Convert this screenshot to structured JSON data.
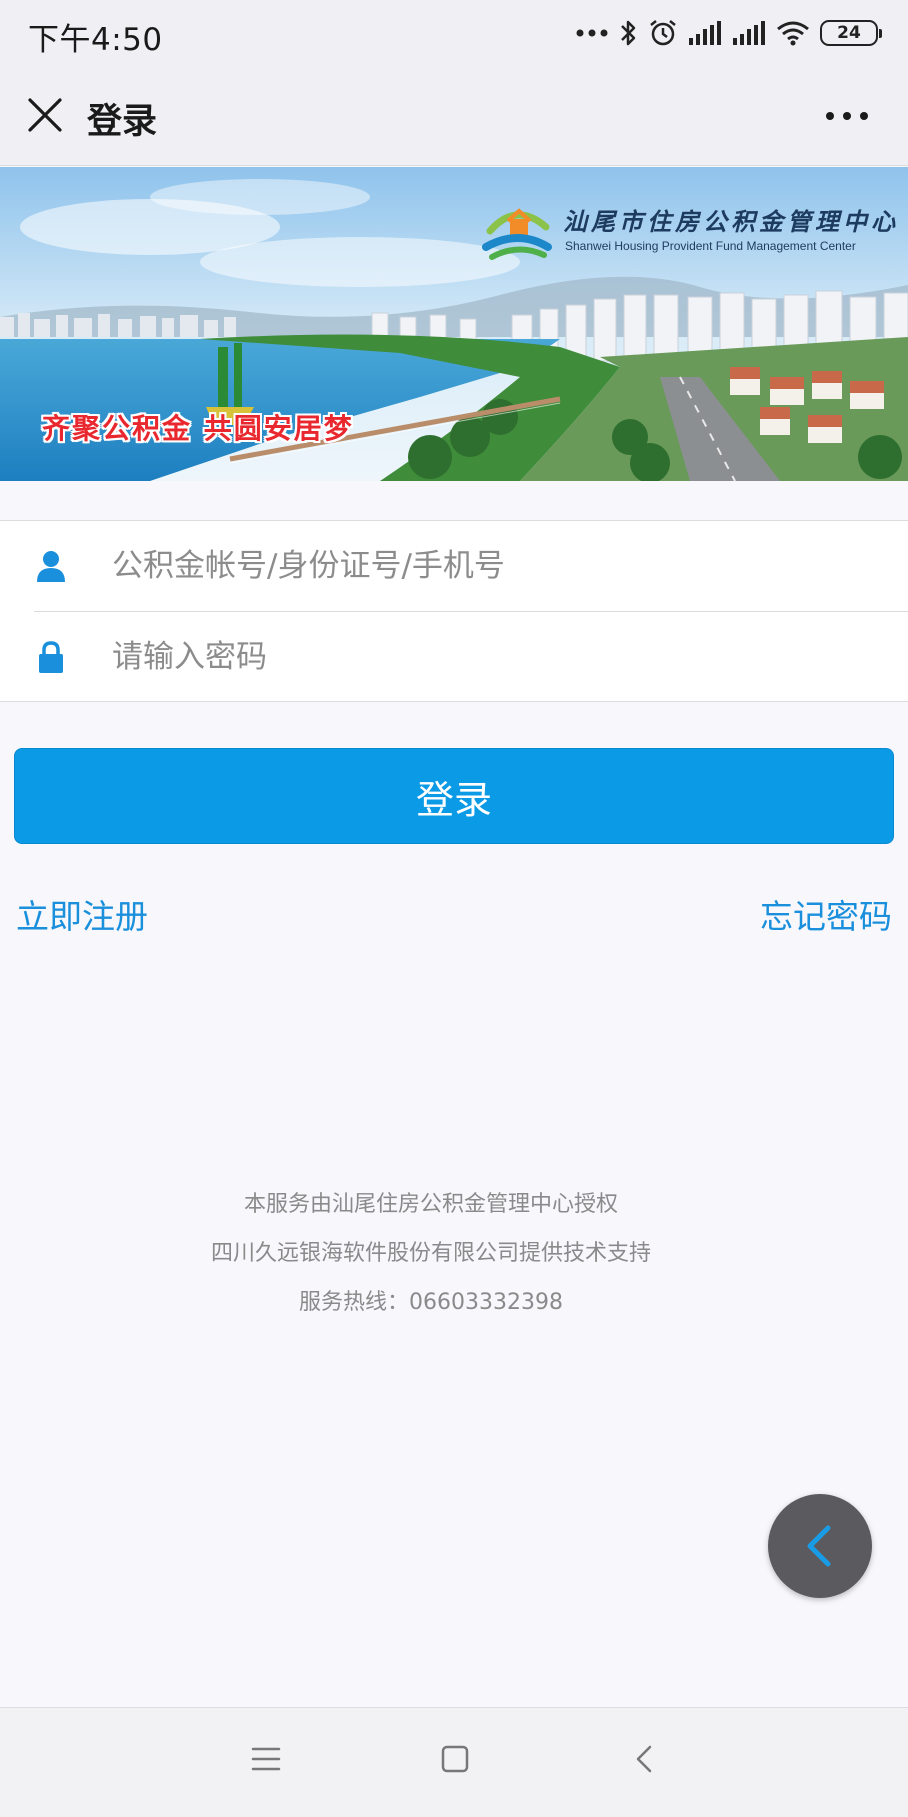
{
  "status_bar": {
    "time": "下午4:50",
    "battery": "24",
    "icons": [
      "more-dots-icon",
      "bluetooth-icon",
      "alarm-icon",
      "signal-icon",
      "signal-icon",
      "wifi-icon",
      "battery-icon"
    ]
  },
  "nav": {
    "title": "登录",
    "close_icon": "close-icon",
    "more_icon": "more-icon"
  },
  "banner": {
    "org_name_cn": "汕尾市住房公积金管理中心",
    "org_name_en": "Shanwei Housing Provident Fund Management Center",
    "slogan": "齐聚公积金  共圆安居梦"
  },
  "form": {
    "account_placeholder": "公积金帐号/身份证号/手机号",
    "account_value": "",
    "password_placeholder": "请输入密码",
    "password_value": "",
    "account_icon": "user-icon",
    "password_icon": "lock-icon"
  },
  "actions": {
    "login_label": "登录",
    "register_label": "立即注册",
    "forgot_label": "忘记密码"
  },
  "footer": {
    "line1": "本服务由汕尾住房公积金管理中心授权",
    "line2": "四川久远银海软件股份有限公司提供技术支持",
    "line3": "服务热线：06603332398"
  },
  "colors": {
    "primary": "#0a9ae6",
    "link": "#1a8fdc",
    "background": "#f8f7fc",
    "slogan": "#e8282e"
  }
}
